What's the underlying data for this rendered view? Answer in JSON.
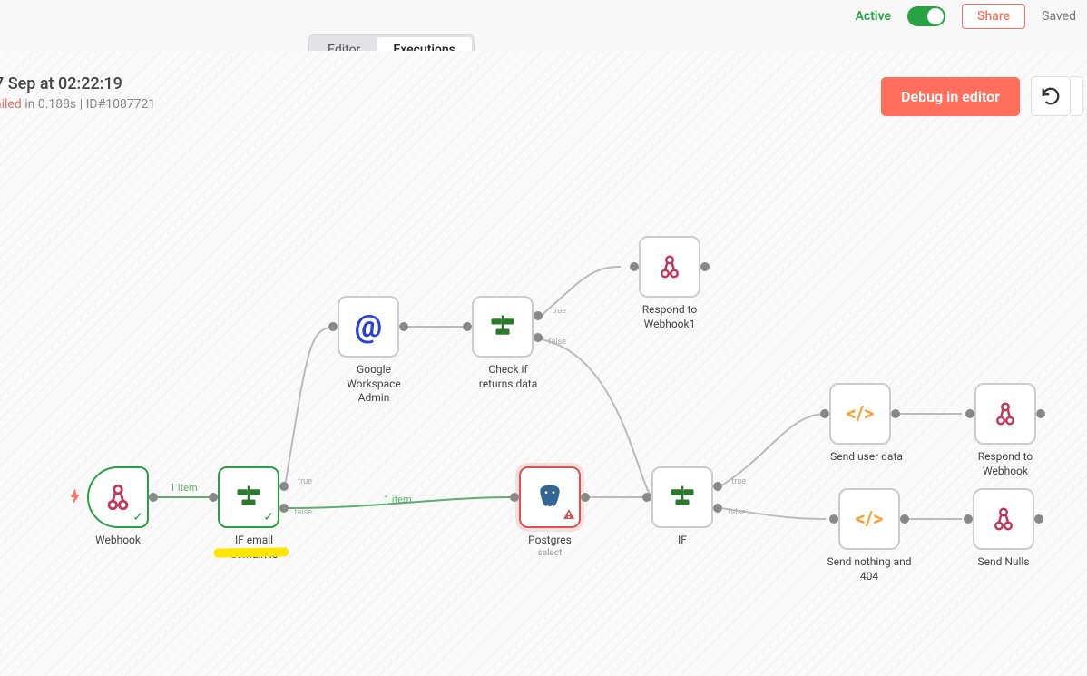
{
  "topbar": {
    "active_label": "Active",
    "share_label": "Share",
    "saved_label": "Saved"
  },
  "tabs": {
    "editor": "Editor",
    "executions": "Executions"
  },
  "execHeader": {
    "date": "7 Sep at 02:22:19",
    "status": "ailed",
    "duration": " in 0.188s ",
    "separator": "|",
    "id": " ID#1087721"
  },
  "actions": {
    "debug": "Debug in editor"
  },
  "nodes": {
    "webhook": {
      "label": "Webhook"
    },
    "if_email": {
      "label": "IF email domain is"
    },
    "gworkspace": {
      "label": "Google Workspace Admin"
    },
    "check_returns": {
      "label": "Check if returns data"
    },
    "respond1": {
      "label": "Respond to Webhook1"
    },
    "postgres": {
      "label": "Postgres",
      "sub": "select"
    },
    "if": {
      "label": "IF"
    },
    "send_user": {
      "label": "Send user data"
    },
    "respond": {
      "label": "Respond to Webhook"
    },
    "send_nothing": {
      "label": "Send nothing and 404"
    },
    "send_nulls": {
      "label": "Send Nulls"
    }
  },
  "portLabels": {
    "true": "true",
    "false": "false"
  },
  "edgeLabels": {
    "one_item": "1 item",
    "one_item2": "1 item"
  }
}
